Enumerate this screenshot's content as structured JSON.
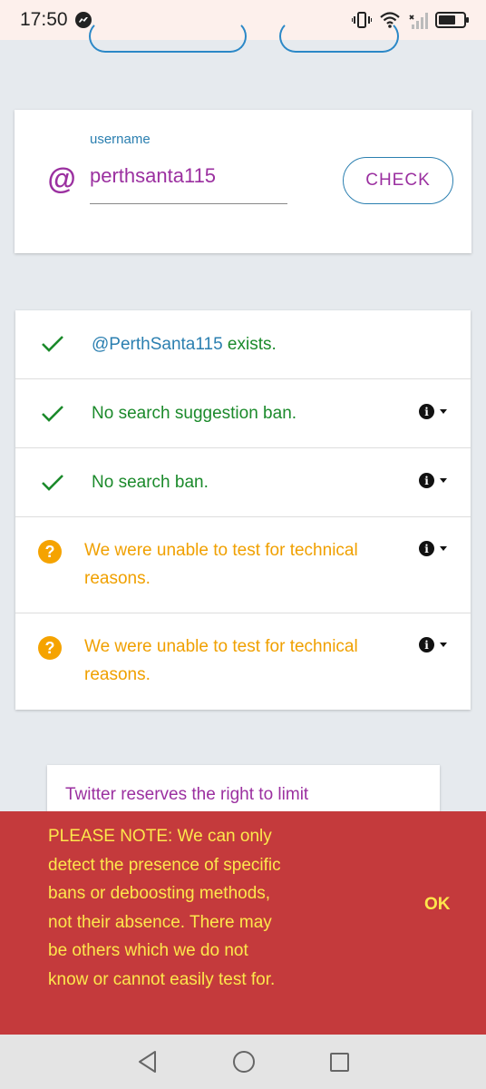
{
  "status_bar": {
    "time": "17:50"
  },
  "search": {
    "field_label": "username",
    "value": "perthsanta115",
    "check_label": "CHECK"
  },
  "results": [
    {
      "status": "ok",
      "handle": "@PerthSanta115",
      "text": " exists.",
      "has_info": false
    },
    {
      "status": "ok",
      "text": "No search suggestion ban.",
      "has_info": true
    },
    {
      "status": "ok",
      "text": "No search ban.",
      "has_info": true
    },
    {
      "status": "unknown",
      "text_line1": "We were unable to test for technical",
      "text_line2": "reasons.",
      "has_info": true
    },
    {
      "status": "unknown",
      "text_line1": "We were unable to test for technical",
      "text_line2": "reasons.",
      "has_info": true
    }
  ],
  "disclaimer": {
    "text": "Twitter reserves the right to limit"
  },
  "snackbar": {
    "lines": [
      "PLEASE NOTE: We can only",
      "detect the presence of specific",
      "bans or deboosting methods,",
      "not their absence. There may",
      "be others which we do not",
      "know or cannot easily test for."
    ],
    "action_label": "OK"
  },
  "colors": {
    "accent_purple": "#9b30a0",
    "accent_blue": "#2b7fb0",
    "success_green": "#1b8a2b",
    "warning_amber": "#f0a000",
    "snackbar_bg": "#c43a3c",
    "snackbar_text": "#fde74c"
  }
}
